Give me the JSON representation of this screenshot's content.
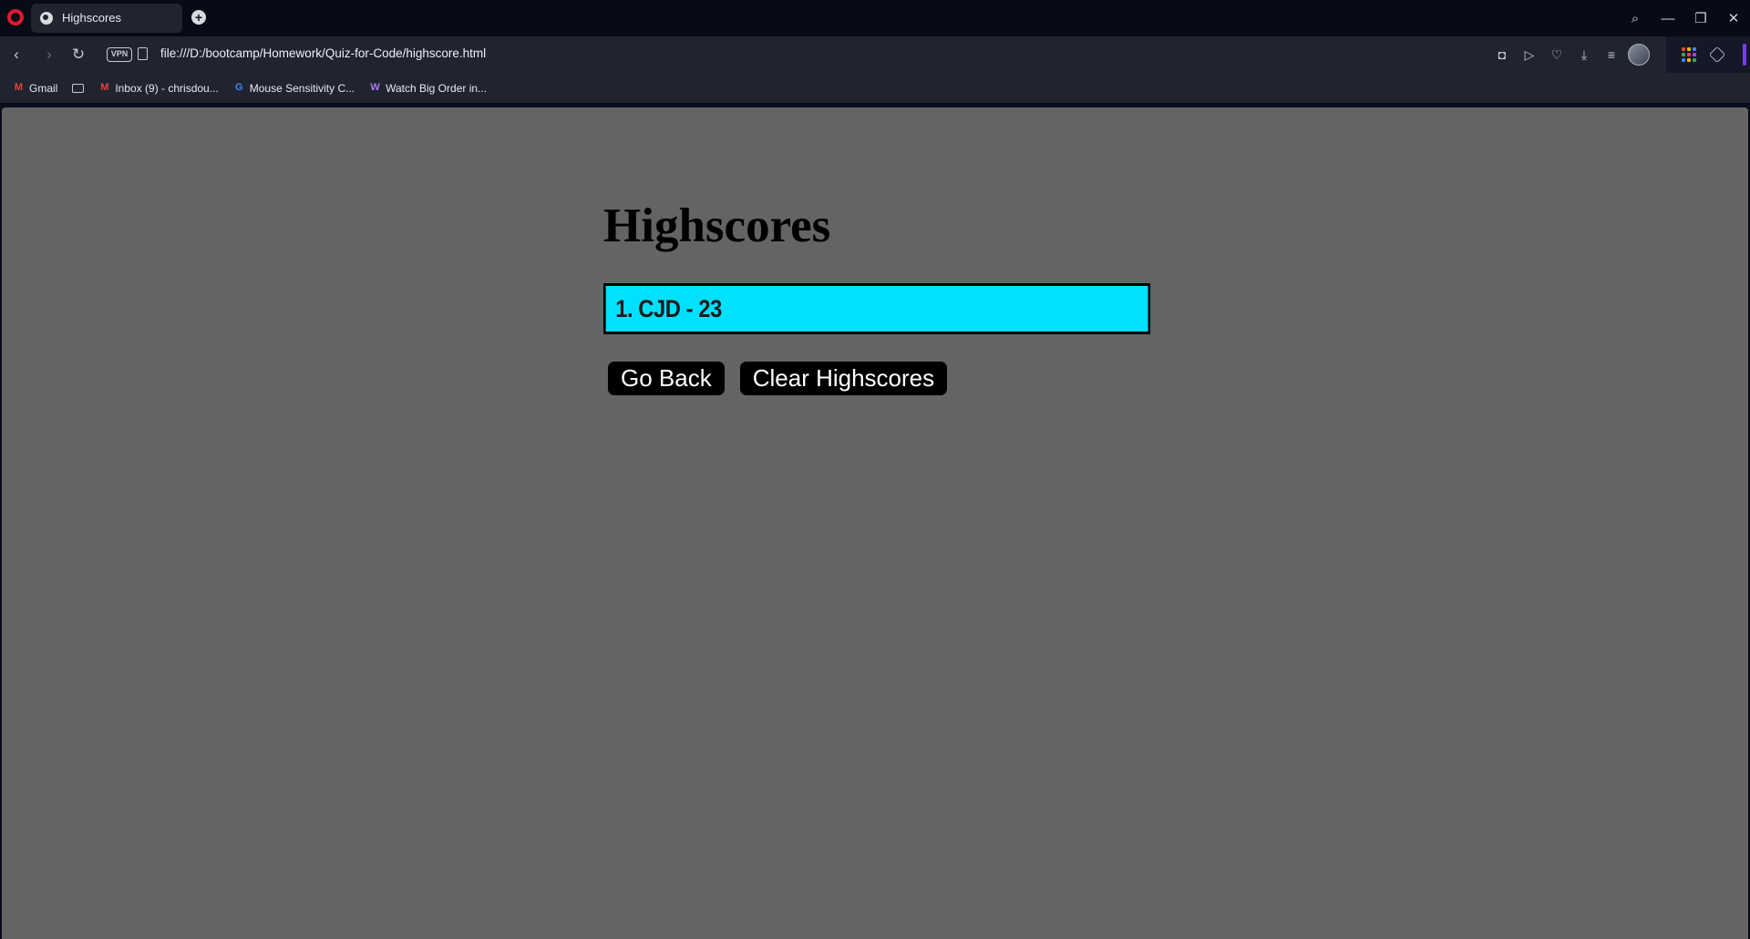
{
  "browser": {
    "tab_title": "Highscores",
    "new_tab_label": "+",
    "url": "file:///D:/bootcamp/Homework/Quiz-for-Code/highscore.html",
    "vpn_label": "VPN",
    "window_controls": {
      "search": "⌕",
      "minimize": "—",
      "restore": "❐",
      "close": "✕"
    },
    "nav": {
      "back": "‹",
      "forward": "›",
      "reload": "↻"
    },
    "address_icons": [
      "camera-icon",
      "send-icon",
      "heart-icon",
      "download-icon",
      "menu-icon"
    ],
    "accent_color": "#7a3cf2"
  },
  "bookmarks": [
    {
      "label": "Gmail",
      "icon": "gmail-icon"
    },
    {
      "label": "",
      "icon": "folder-icon"
    },
    {
      "label": "Inbox (9) - chrisdou...",
      "icon": "gmail-icon"
    },
    {
      "label": "Mouse Sensitivity C...",
      "icon": "google-icon"
    },
    {
      "label": "Watch Big Order in...",
      "icon": "w-icon"
    }
  ],
  "page": {
    "heading": "Highscores",
    "scores": [
      "1. CJD - 23"
    ],
    "go_back_label": "Go Back",
    "clear_label": "Clear Highscores",
    "background_color": "#646464",
    "score_color": "#00e1ff"
  }
}
